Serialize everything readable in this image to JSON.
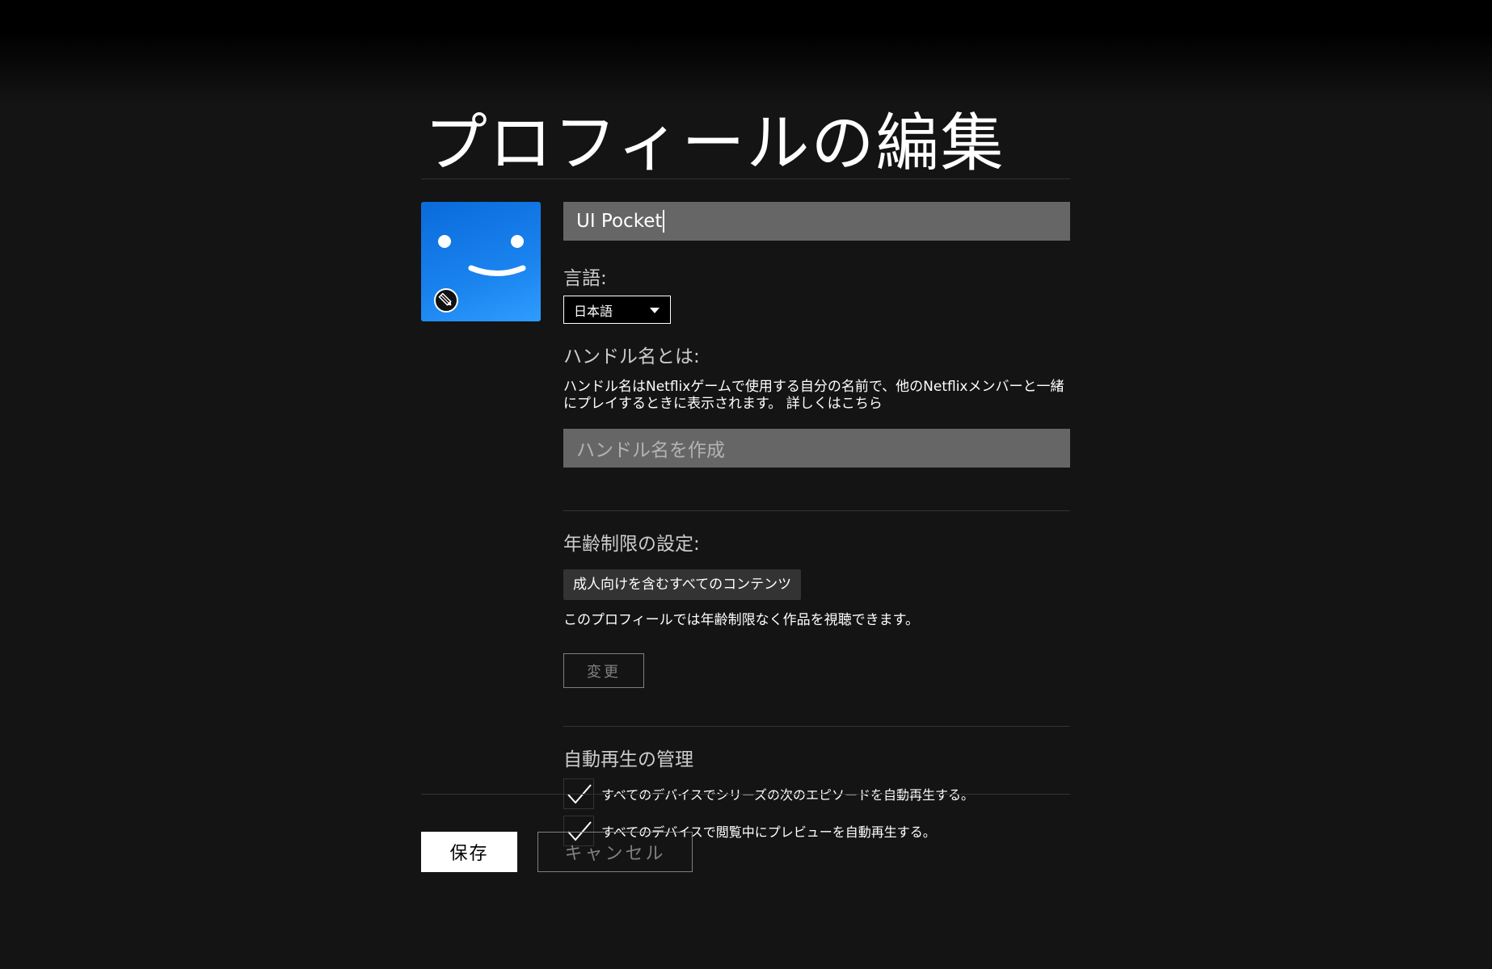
{
  "page": {
    "title": "プロフィールの編集"
  },
  "profile": {
    "avatar_icon": "smiley-face-icon",
    "edit_icon": "pencil-icon",
    "avatar_color": "#1a83ee",
    "name_value": "UI Pocket"
  },
  "language": {
    "label": "言語:",
    "selected": "日本語"
  },
  "handle": {
    "label": "ハンドル名とは:",
    "description": "ハンドル名はNetflixゲームで使用する自分の名前で、他のNetflixメンバーと一緒にプレイするときに表示されます。 詳しくはこちら",
    "placeholder": "ハンドル名を作成"
  },
  "maturity": {
    "label": "年齢制限の設定:",
    "badge": "成人向けを含むすべてのコンテンツ",
    "description": "このプロフィールでは年齢制限なく作品を視聴できます。",
    "change_label": "変更"
  },
  "autoplay": {
    "label": "自動再生の管理",
    "options": [
      {
        "label": "すべてのデバイスでシリーズの次のエピソードを自動再生する。",
        "checked": true
      },
      {
        "label": "すべてのデバイスで閲覧中にプレビューを自動再生する。",
        "checked": true
      }
    ]
  },
  "actions": {
    "save_label": "保存",
    "cancel_label": "キャンセル"
  }
}
